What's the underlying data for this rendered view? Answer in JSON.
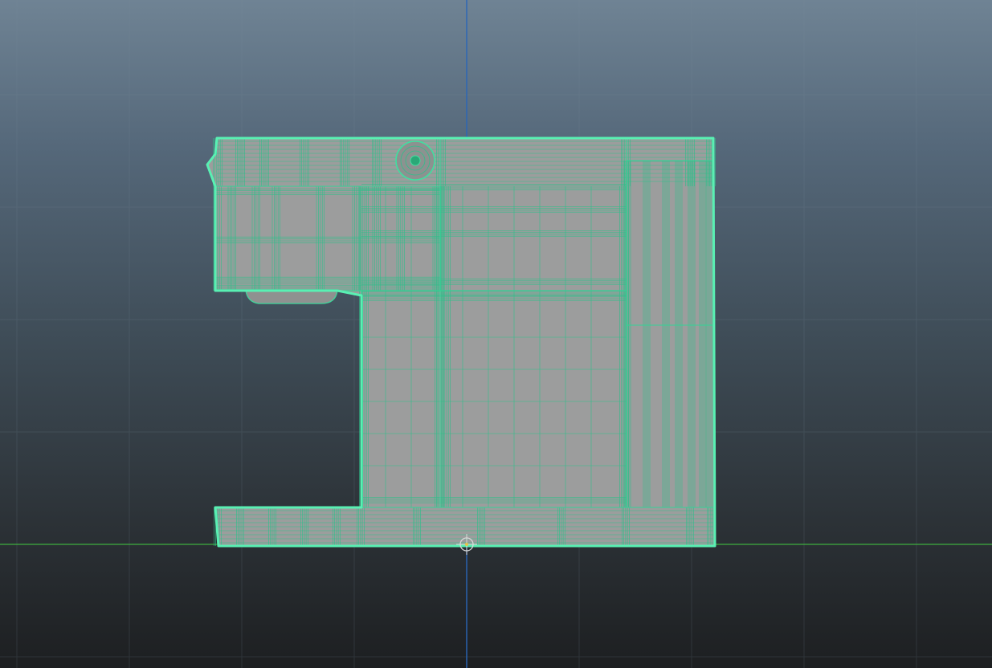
{
  "viewport": {
    "view": "front",
    "grid_visible": true,
    "shading": "wireframe-on-shaded"
  },
  "colors": {
    "background_top": "#6f8394",
    "background_bottom": "#1d1f21",
    "grid_line": "#76899a",
    "vertical_axis": "#2a66b8",
    "horizontal_axis": "#3fae3f",
    "mesh_fill": "#9b9c9c",
    "wire": "#2fc792",
    "wire_bright": "#57f2b5"
  },
  "scene": {
    "selected_object": "coffee-machine-mesh",
    "selection_state": "selected",
    "pivot_manipulator": "origin-pivot-icon"
  }
}
